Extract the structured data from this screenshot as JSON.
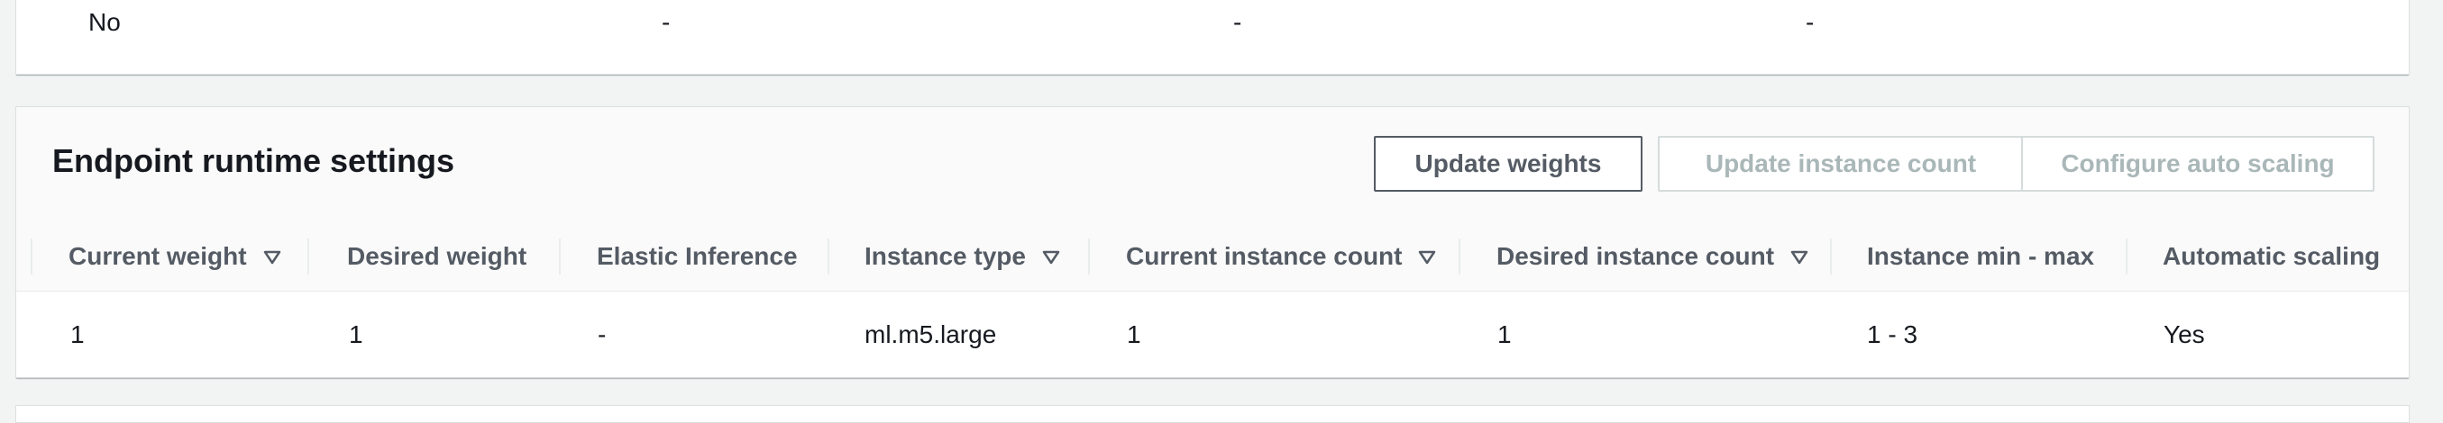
{
  "previous_panel": {
    "row": [
      "No",
      "-",
      "-",
      "-"
    ]
  },
  "endpoint_runtime": {
    "title": "Endpoint runtime settings",
    "buttons": {
      "update_weights": "Update weights",
      "update_instance_count": "Update instance count",
      "configure_auto_scaling": "Configure auto scaling"
    },
    "columns": [
      {
        "label": "Current weight",
        "sortable": true
      },
      {
        "label": "Desired weight",
        "sortable": false
      },
      {
        "label": "Elastic Inference",
        "sortable": false
      },
      {
        "label": "Instance type",
        "sortable": true
      },
      {
        "label": "Current instance count",
        "sortable": true
      },
      {
        "label": "Desired instance count",
        "sortable": true
      },
      {
        "label": "Instance min - max",
        "sortable": false
      },
      {
        "label": "Automatic scaling",
        "sortable": false
      }
    ],
    "rows": [
      [
        "1",
        "1",
        "-",
        "ml.m5.large",
        "1",
        "1",
        "1 - 3",
        "Yes"
      ]
    ]
  },
  "colors": {
    "header_bg": "#fafafa",
    "text": "#16191f",
    "secondary_text": "#545b64",
    "disabled_text": "#aab7b8",
    "border": "#eaeded"
  }
}
